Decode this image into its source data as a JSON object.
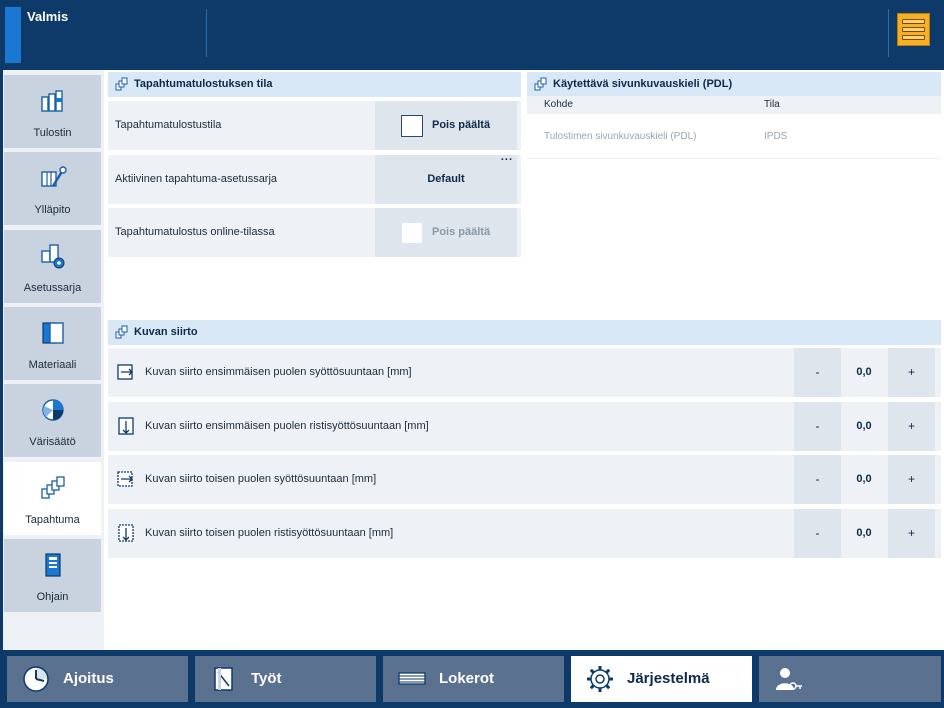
{
  "status": {
    "text": "Valmis"
  },
  "icons": {
    "server": "server-stack-icon"
  },
  "colors": {
    "header_bg": "#0e3a6a",
    "status_accent": "#1a78d2",
    "server_button": "#f5b122",
    "section_header_bg": "#d9e8f7",
    "tab_inactive": "#5a7290"
  },
  "sidebar": {
    "items": [
      {
        "label": "Tulostin",
        "icon": "printer-icon",
        "active": false
      },
      {
        "label": "Ylläpito",
        "icon": "maintenance-icon",
        "active": false
      },
      {
        "label": "Asetussarja",
        "icon": "preset-icon",
        "active": false
      },
      {
        "label": "Materiaali",
        "icon": "media-icon",
        "active": false
      },
      {
        "label": "Värisäätö",
        "icon": "color-management-icon",
        "active": false
      },
      {
        "label": "Tapahtuma",
        "icon": "transaction-icon",
        "active": true
      },
      {
        "label": "Ohjain",
        "icon": "controller-icon",
        "active": false
      }
    ]
  },
  "transaction_section": {
    "title": "Tapahtumatulostuksen tila",
    "rows": [
      {
        "label": "Tapahtumatulostustila",
        "value": "Pois päältä",
        "checked": false,
        "disabled": false
      },
      {
        "label": "Aktiivinen tapahtuma-asetussarja",
        "value": "Default",
        "more": "..."
      },
      {
        "label": "Tapahtumatulostus online-tilassa",
        "value": "Pois päältä",
        "checked": false,
        "disabled": true
      }
    ]
  },
  "pdl_section": {
    "title": "Käytettävä sivunkuvauskieli (PDL)",
    "columns": [
      "Kohde",
      "Tila"
    ],
    "rows": [
      {
        "target": "Tulostimen sivunkuvauskieli (PDL)",
        "state": "IPDS"
      }
    ]
  },
  "image_shift_section": {
    "title": "Kuvan siirto",
    "minus_label": "-",
    "plus_label": "+",
    "rows": [
      {
        "label": "Kuvan siirto ensimmäisen puolen syöttösuuntaan [mm]",
        "value": "0,0"
      },
      {
        "label": "Kuvan siirto ensimmäisen puolen ristisyöttösuuntaan [mm]",
        "value": "0,0"
      },
      {
        "label": "Kuvan siirto toisen puolen syöttösuuntaan [mm]",
        "value": "0,0"
      },
      {
        "label": "Kuvan siirto toisen puolen ristisyöttösuuntaan [mm]",
        "value": "0,0"
      }
    ]
  },
  "bottom_tabs": [
    {
      "label": "Ajoitus",
      "icon": "clock-icon",
      "active": false
    },
    {
      "label": "Työt",
      "icon": "jobs-icon",
      "active": false
    },
    {
      "label": "Lokerot",
      "icon": "trays-icon",
      "active": false
    },
    {
      "label": "Järjestelmä",
      "icon": "gear-icon",
      "active": true
    },
    {
      "label": "",
      "icon": "user-key-icon",
      "active": false
    }
  ]
}
